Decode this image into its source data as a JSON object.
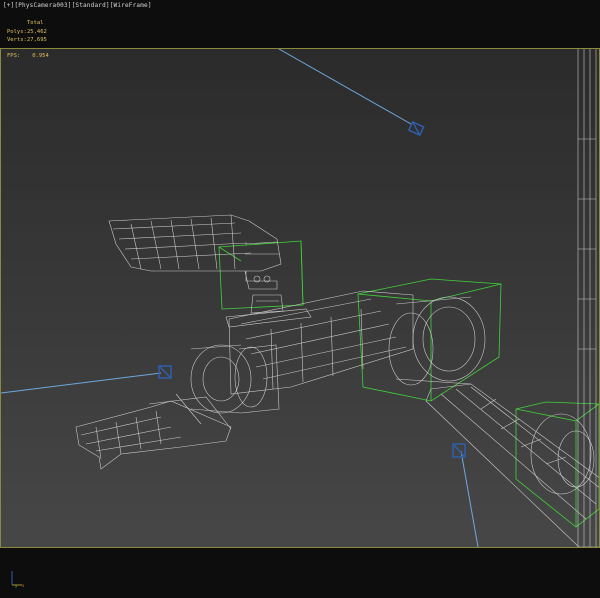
{
  "viewport_label": {
    "plus": "[+]",
    "camera": "[PhysCamera003]",
    "shading": "[Standard]",
    "mode": "[WireFrame]"
  },
  "stats": {
    "header": "Total",
    "polys_label": "Polys:",
    "polys_value": "25,462",
    "verts_label": "Verts:",
    "verts_value": "27,695"
  },
  "fps": {
    "label": "FPS:",
    "value": "0.954"
  },
  "colors": {
    "wire": "#d9d9d9",
    "bbox": "#41d13a",
    "camera": "#2e5fa8",
    "camera_line": "#6fa8dc",
    "viewport_border": "#8a8a3a",
    "stats_text": "#e0c060"
  },
  "icons": [
    "camera-icon",
    "axis-gizmo-icon"
  ]
}
